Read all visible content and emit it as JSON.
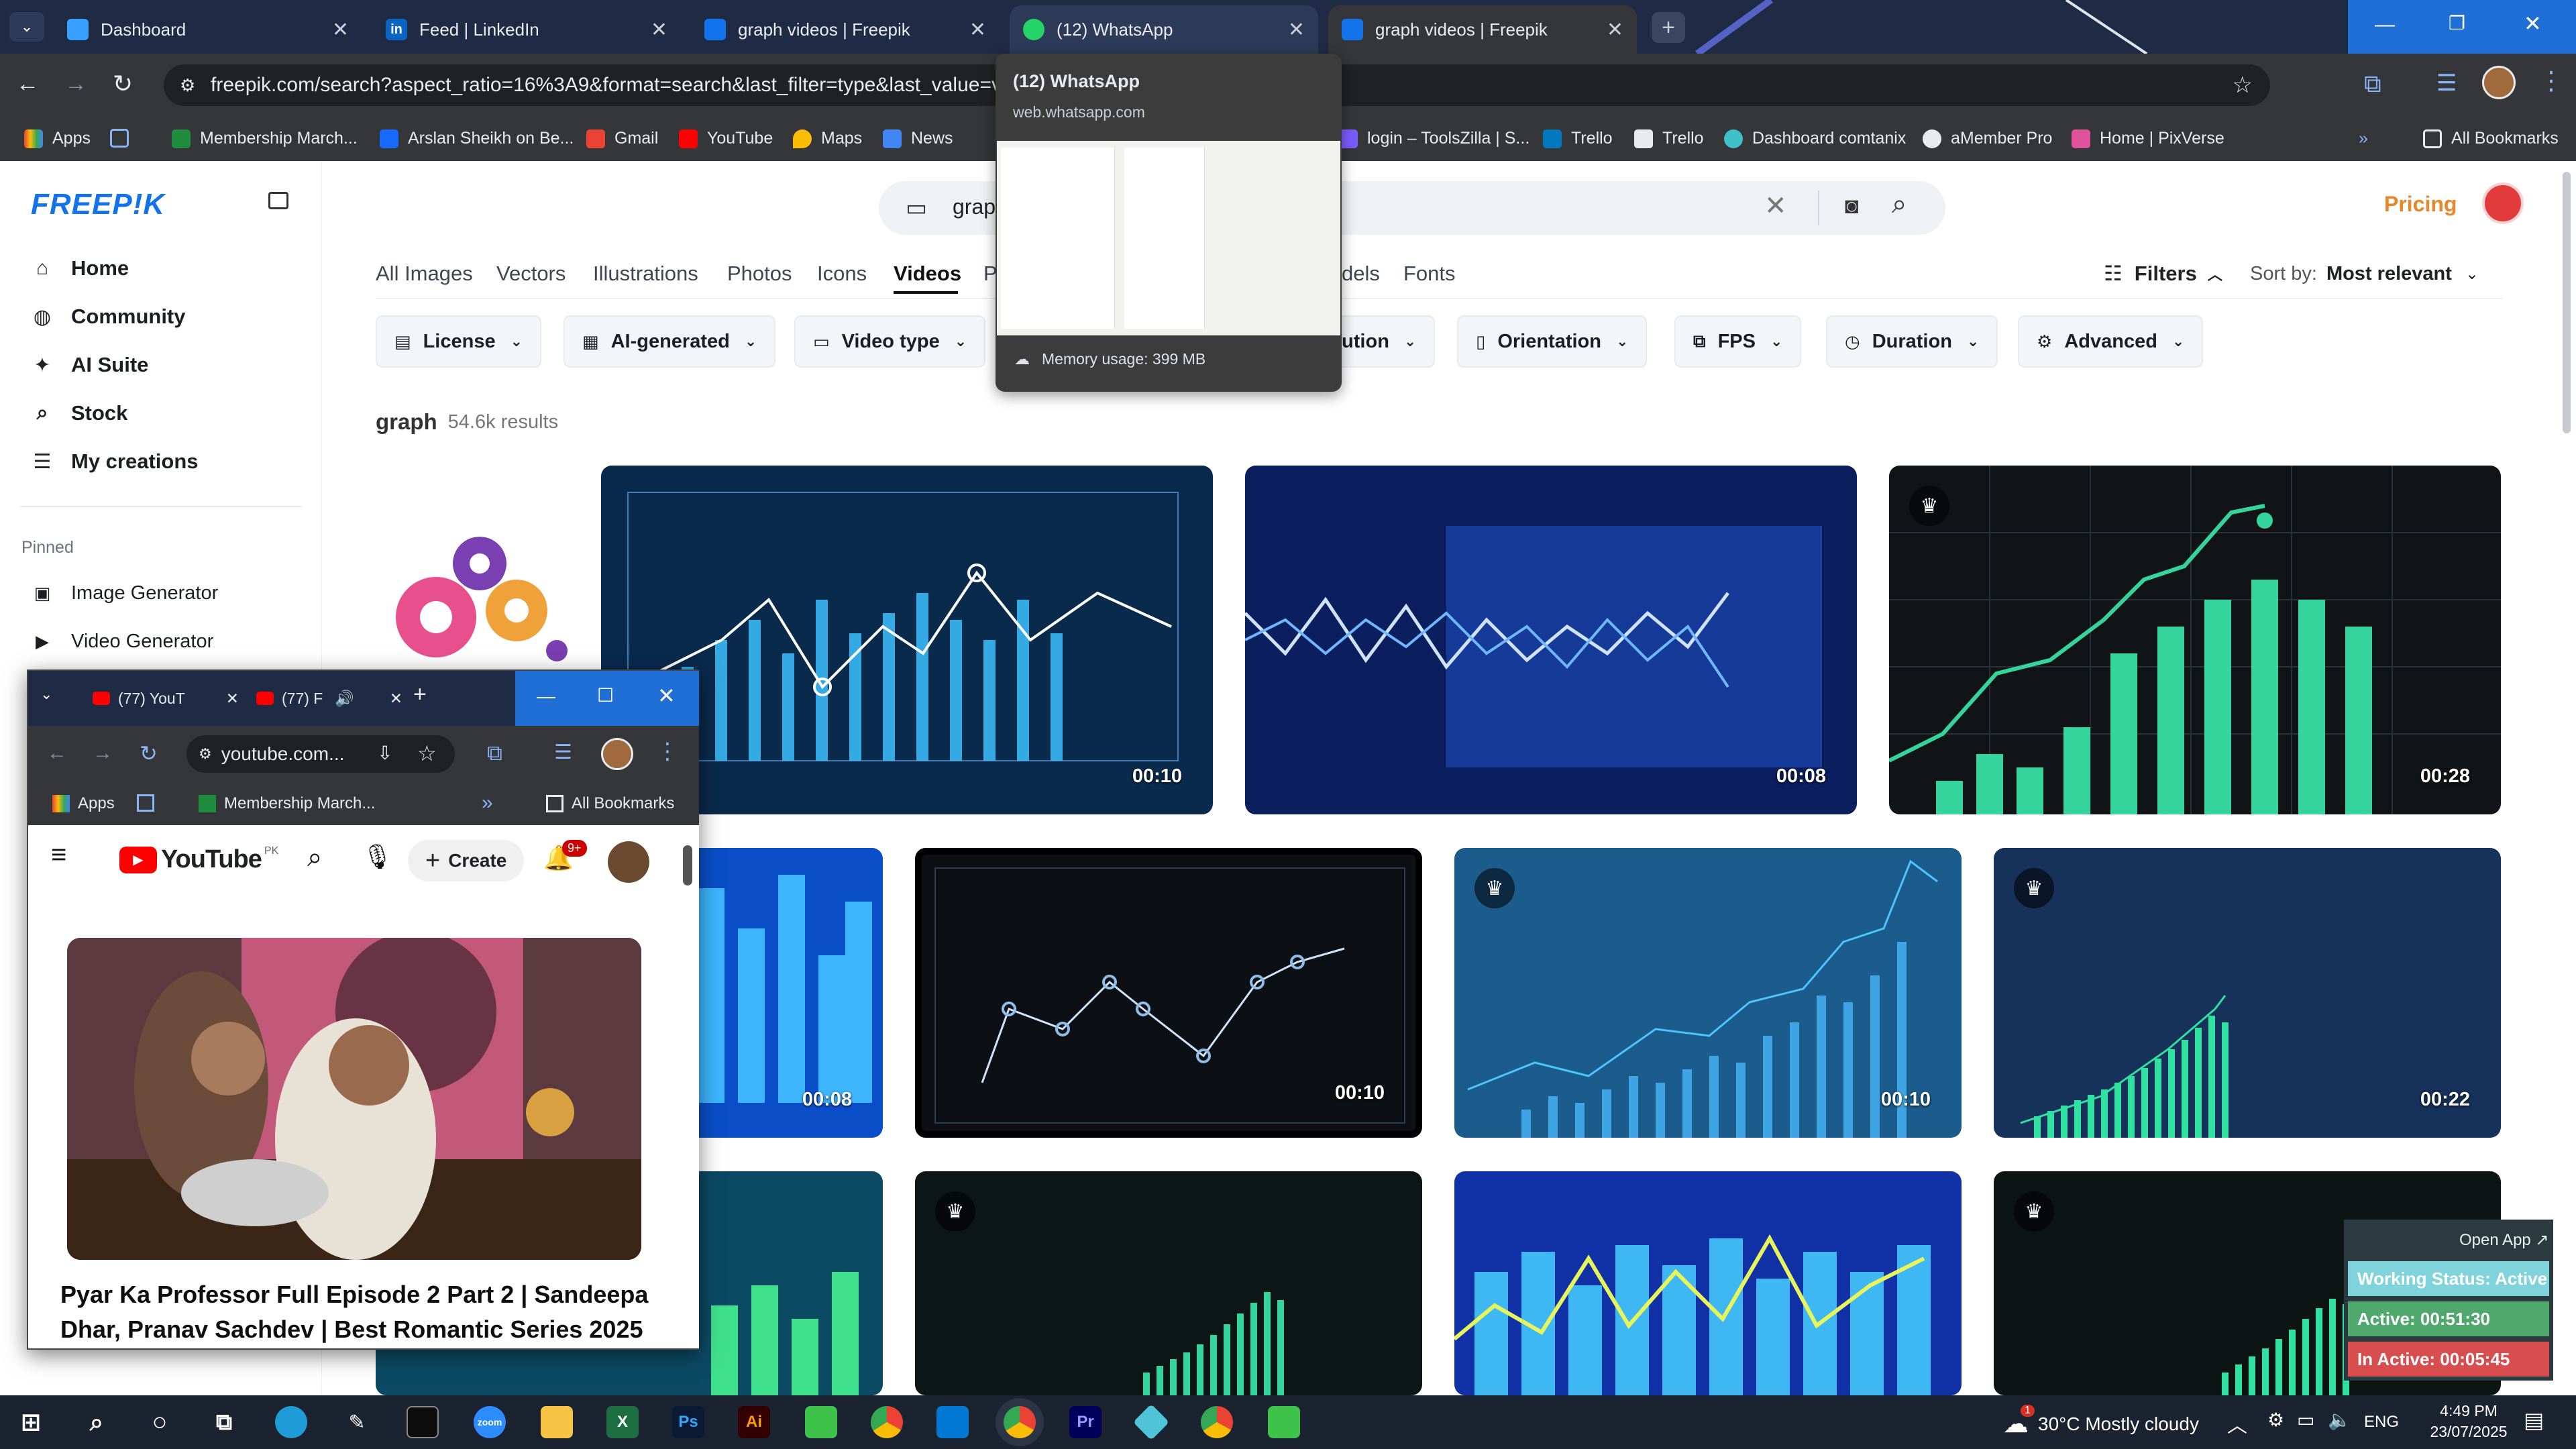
{
  "browser": {
    "tabs": [
      {
        "title": "Dashboard",
        "color": "#1a73e8"
      },
      {
        "title": "Feed | LinkedIn",
        "color": "#0a66c2"
      },
      {
        "title": "graph videos | Freepik",
        "color": "#1273eb"
      },
      {
        "title": "(12) WhatsApp",
        "color": "#25d366"
      },
      {
        "title": "graph videos | Freepik",
        "color": "#1273eb"
      }
    ],
    "url": "freepik.com/search?aspect_ratio=16%3A9&format=search&last_filter=type&last_value=video&",
    "bookmarks": [
      "Apps",
      "Membership March...",
      "Arslan Sheikh on Be...",
      "Gmail",
      "YouTube",
      "Maps",
      "News",
      "login – ToolsZilla | S...",
      "Trello",
      "Trello",
      "Dashboard comtanix",
      "aMember Pro",
      "Home | PixVerse",
      "All Bookmarks"
    ]
  },
  "whatsapp_popup": {
    "title": "(12) WhatsApp",
    "url": "web.whatsapp.com",
    "memory": "Memory usage: 399 MB"
  },
  "freepik": {
    "logo": "FREEP!K",
    "nav": [
      "Home",
      "Community",
      "AI Suite",
      "Stock",
      "My creations"
    ],
    "pinned_label": "Pinned",
    "pinned": [
      "Image Generator",
      "Video Generator"
    ],
    "search_value": "grap",
    "pricing": "Pricing",
    "categories": [
      "All Images",
      "Vectors",
      "Illustrations",
      "Photos",
      "Icons",
      "Videos",
      "P",
      "dels",
      "Fonts"
    ],
    "filters_label": "Filters",
    "sort_label": "Sort by:",
    "sort_value": "Most relevant",
    "chips": [
      "License",
      "AI-generated",
      "Video type",
      "lution",
      "Orientation",
      "FPS",
      "Duration",
      "Advanced"
    ],
    "query": "graph",
    "results": "54.6k results",
    "durations": [
      "00:10",
      "00:08",
      "00:28",
      "00:08",
      "00:10",
      "00:10",
      "00:22"
    ]
  },
  "youtube_window": {
    "tabs": [
      "(77) YouT",
      "(77) F"
    ],
    "url": "youtube.com...",
    "bookmarks": [
      "Apps",
      "Membership March...",
      "All Bookmarks"
    ],
    "logo_text": "YouTube",
    "region": "PK",
    "create": "Create",
    "notif": "9+",
    "video_title": "Pyar Ka Professor Full Episode 2 Part 2 | Sandeepa Dhar, Pranav Sachdev | Best Romantic Series 2025"
  },
  "status_widget": {
    "open_app": "Open App ↗",
    "working": "Working Status: Active",
    "active": "Active: 00:51:30",
    "inactive": "In Active: 00:05:45"
  },
  "taskbar": {
    "weather": "30°C  Mostly cloudy",
    "weather_badge": "1",
    "lang": "ENG",
    "time": "4:49 PM",
    "date": "23/07/2025"
  }
}
